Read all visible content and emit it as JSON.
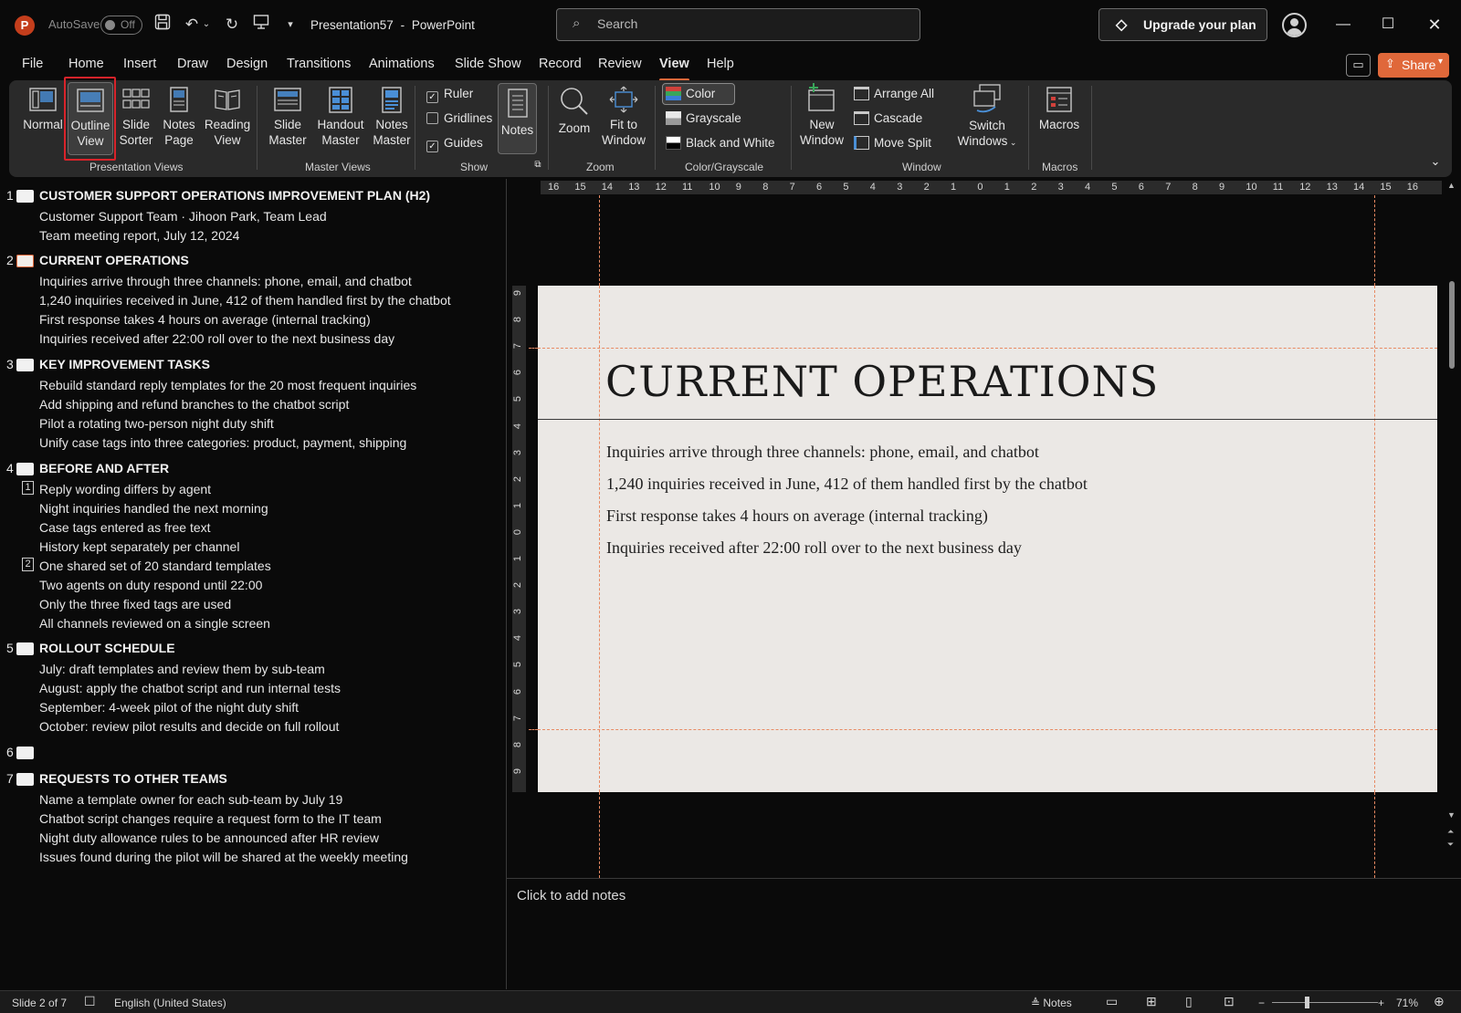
{
  "app": {
    "autosave_label": "AutoSave",
    "autosave_state": "Off",
    "document_title": "Presentation57",
    "title_separator": "-",
    "app_name": "PowerPoint",
    "search_placeholder": "Search",
    "upgrade_label": "Upgrade your plan"
  },
  "menu": {
    "tabs": [
      "File",
      "Home",
      "Insert",
      "Draw",
      "Design",
      "Transitions",
      "Animations",
      "Slide Show",
      "Record",
      "Review",
      "View",
      "Help"
    ],
    "active_tab": "View",
    "share_label": "Share"
  },
  "ribbon": {
    "presentation_views": {
      "group_label": "Presentation Views",
      "normal": "Normal",
      "outline_1": "Outline",
      "outline_2": "View",
      "sorter_1": "Slide",
      "sorter_2": "Sorter",
      "notes_page_1": "Notes",
      "notes_page_2": "Page",
      "reading_1": "Reading",
      "reading_2": "View"
    },
    "master_views": {
      "group_label": "Master Views",
      "slide_master_1": "Slide",
      "slide_master_2": "Master",
      "handout_master_1": "Handout",
      "handout_master_2": "Master",
      "notes_master_1": "Notes",
      "notes_master_2": "Master"
    },
    "show": {
      "group_label": "Show",
      "ruler": "Ruler",
      "ruler_checked": true,
      "gridlines": "Gridlines",
      "gridlines_checked": false,
      "guides": "Guides",
      "guides_checked": true,
      "notes": "Notes"
    },
    "zoom": {
      "group_label": "Zoom",
      "zoom": "Zoom",
      "fit_1": "Fit to",
      "fit_2": "Window"
    },
    "color": {
      "group_label": "Color/Grayscale",
      "color": "Color",
      "grayscale": "Grayscale",
      "bw": "Black and White"
    },
    "window": {
      "group_label": "Window",
      "new_1": "New",
      "new_2": "Window",
      "arrange_all": "Arrange All",
      "cascade": "Cascade",
      "move_split": "Move Split",
      "switch_1": "Switch",
      "switch_2": "Windows"
    },
    "macros": {
      "group_label": "Macros",
      "macros": "Macros"
    }
  },
  "outline": {
    "slides": [
      {
        "num": "1",
        "title": "CUSTOMER SUPPORT OPERATIONS IMPROVEMENT PLAN (H2)",
        "lines": [
          "Customer Support Team · Jihoon Park, Team Lead",
          "Team meeting report, July 12, 2024"
        ]
      },
      {
        "num": "2",
        "title": "CURRENT OPERATIONS",
        "lines": [
          "Inquiries arrive through three channels: phone, email, and chatbot",
          "1,240 inquiries received in June, 412 of them handled first by the chatbot",
          "First response takes 4 hours on average (internal tracking)",
          "Inquiries received after 22:00 roll over to the next business day"
        ]
      },
      {
        "num": "3",
        "title": "KEY IMPROVEMENT TASKS",
        "lines": [
          "Rebuild standard reply templates for the 20 most frequent inquiries",
          "Add shipping and refund branches to the chatbot script",
          "Pilot a rotating two-person night duty shift",
          "Unify case tags into three categories: product, payment, shipping"
        ]
      },
      {
        "num": "4",
        "title": "BEFORE AND AFTER",
        "lines": [
          "Reply wording differs by agent",
          "Night inquiries handled the next morning",
          "Case tags entered as free text",
          "History kept separately per channel",
          "One shared set of 20 standard templates",
          "Two agents on duty respond until 22:00",
          "Only the three fixed tags are used",
          "All channels reviewed on a single screen"
        ],
        "badges": [
          "1",
          "2"
        ]
      },
      {
        "num": "5",
        "title": "ROLLOUT SCHEDULE",
        "lines": [
          "July: draft templates and review them by sub-team",
          "August: apply the chatbot script and run internal tests",
          "September: 4-week pilot of the night duty shift",
          "October: review pilot results and decide on full rollout"
        ]
      },
      {
        "num": "6",
        "title": "",
        "lines": []
      },
      {
        "num": "7",
        "title": "REQUESTS TO OTHER TEAMS",
        "lines": [
          "Name a template owner for each sub-team by July 19",
          "Chatbot script changes require a request form to the IT team",
          "Night duty allowance rules to be announced after HR review",
          "Issues found during the pilot will be shared at the weekly meeting"
        ]
      }
    ]
  },
  "ruler": {
    "horizontal": [
      "16",
      "15",
      "14",
      "13",
      "12",
      "11",
      "10",
      "9",
      "8",
      "7",
      "6",
      "5",
      "4",
      "3",
      "2",
      "1",
      "0",
      "1",
      "2",
      "3",
      "4",
      "5",
      "6",
      "7",
      "8",
      "9",
      "10",
      "11",
      "12",
      "13",
      "14",
      "15",
      "16"
    ],
    "vertical": [
      "9",
      "8",
      "7",
      "6",
      "5",
      "4",
      "3",
      "2",
      "1",
      "0",
      "1",
      "2",
      "3",
      "4",
      "5",
      "6",
      "7",
      "8",
      "9"
    ]
  },
  "slide": {
    "title": "CURRENT OPERATIONS",
    "lines": [
      "Inquiries arrive through three channels: phone, email, and chatbot",
      "1,240 inquiries received in June, 412 of them handled first by the chatbot",
      "First response takes 4 hours on average (internal tracking)",
      "Inquiries received after 22:00 roll over to the next business day"
    ]
  },
  "notes": {
    "placeholder": "Click to add notes"
  },
  "status": {
    "slide_info": "Slide 2 of 7",
    "language": "English (United States)",
    "notes_label": "Notes",
    "zoom_minus": "−",
    "zoom_plus": "+",
    "zoom_level": "71%"
  },
  "colors": {
    "accent": "#e0683a",
    "highlight": "#d8232a",
    "ribbon_bg": "#2a2a2a",
    "slide_bg": "#ebe8e5"
  }
}
